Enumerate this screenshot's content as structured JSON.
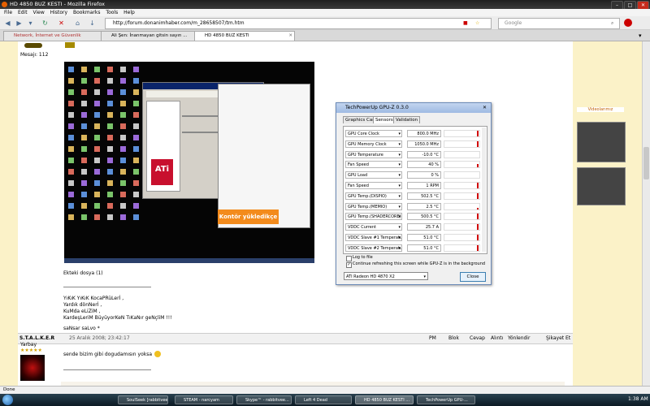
{
  "window": {
    "title": "HD 4850 BUZ KESTI - Mozilla Firefox"
  },
  "menu": [
    "File",
    "Edit",
    "View",
    "History",
    "Bookmarks",
    "Tools",
    "Help"
  ],
  "nav": {
    "url": "http://forum.donanimhaber.com/m_28658507/tm.htm",
    "search_placeholder": "Google"
  },
  "tabs": [
    {
      "label": "Network, İnternet ve Güvenlik"
    },
    {
      "label": "Ali Şen: İnanmayan gitsin sayın ..."
    },
    {
      "label": "HD 4850 BUZ KESTI"
    }
  ],
  "post1": {
    "mesaj": "Mesajı: 112",
    "embedded_button": "Kontör yükledikçe",
    "attachment_line": "Ekteki dosya (1)",
    "lines": [
      "YıKıK YıKıK KocaPRüLerİ ,",
      "Yardık dönNerİ ,",
      "KuMda eLiZiM ,",
      "KardeşLeriM BüyüyorKeN TıKaNır geNçliM !!!"
    ],
    "signoff": "saNsar saLvo *"
  },
  "gpuz": {
    "title": "TechPowerUp GPU-Z 0.3.0",
    "tabs": [
      "Graphics Card",
      "Sensors",
      "Validation"
    ],
    "sensors": [
      {
        "label": "GPU Core Clock",
        "value": "800.0 MHz",
        "level": 0.9
      },
      {
        "label": "GPU Memory Clock",
        "value": "1050.0 MHz",
        "level": 0.9
      },
      {
        "label": "GPU Temperature",
        "value": "-10.0 °C",
        "level": 0.0
      },
      {
        "label": "Fan Speed",
        "value": "40 %",
        "level": 0.5
      },
      {
        "label": "GPU Load",
        "value": "0 %",
        "level": 0.0
      },
      {
        "label": "Fan Speed",
        "value": "1 RPM",
        "level": 0.9
      },
      {
        "label": "GPU Temp.(DISPIO)",
        "value": "502.5 °C",
        "level": 0.9
      },
      {
        "label": "GPU Temp.(MEMIO)",
        "value": "2.5 °C",
        "level": 0.3
      },
      {
        "label": "GPU Temp.(SHADERCORE)",
        "value": "500.5 °C",
        "level": 0.9
      },
      {
        "label": "VDDC Current",
        "value": "25.7 A",
        "level": 0.9
      },
      {
        "label": "VDDC Slave #1 Temperature",
        "value": "51.0 °C",
        "level": 0.9
      },
      {
        "label": "VDDC Slave #2 Temperature",
        "value": "51.0 °C",
        "level": 0.9
      }
    ],
    "log_to_file": "Log to file",
    "continue_refresh": "Continue refreshing this screen while GPU-Z is in the background",
    "card": "ATI Radeon HD 4870 X2",
    "close": "Close"
  },
  "post2": {
    "user": "S.T.A.L.K.E.R",
    "rank": "Yarbay",
    "stars": "★★★★★",
    "date": "25 Aralık 2008; 23:42:17",
    "text": "sende bizim gibi dogudamısın yoksa",
    "actions": [
      "PM",
      "Blok",
      "Cevap",
      "Alıntı",
      "Yönlendir",
      "Şikayet Et"
    ]
  },
  "sidebar": {
    "label": "Videolarımız"
  },
  "status": {
    "text": "Done"
  },
  "taskbar": {
    "items": [
      "SoulSeek [rabbitvee...",
      "STEAM - narcyam",
      "Skype™ - rabbitvee...",
      "Left 4 Dead",
      "HD 4850 BUZ KESTI ...",
      "TechPowerUp GPU-..."
    ],
    "clock": "1:38 AM"
  },
  "colors": {
    "accent": "#f38b1c",
    "page_bg": "#fbf2c8",
    "graph_bar": "#d00000",
    "ati_red": "#c8102e"
  }
}
